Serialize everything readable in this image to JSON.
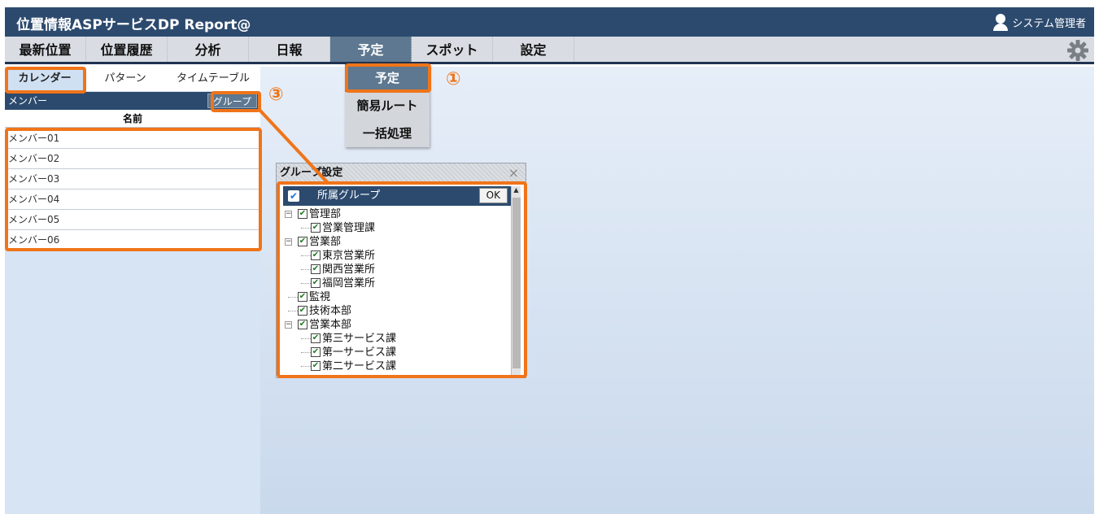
{
  "app": {
    "title": "位置情報ASPサービスDP Report@",
    "user": "システム管理者"
  },
  "nav": {
    "items": [
      "最新位置",
      "位置履歴",
      "分析",
      "日報",
      "予定",
      "スポット",
      "設定"
    ],
    "active_index": 4
  },
  "subnav": {
    "items": [
      "カレンダー",
      "パターン",
      "タイムテーブル"
    ],
    "active_index": 0
  },
  "member_panel": {
    "header": "メンバー",
    "group_button": "グループ",
    "column_name": "名前",
    "members": [
      "メンバー01",
      "メンバー02",
      "メンバー03",
      "メンバー04",
      "メンバー05",
      "メンバー06"
    ]
  },
  "dropdown": {
    "items": [
      "予定",
      "簡易ルート",
      "一括処理"
    ],
    "active_index": 0
  },
  "markers": {
    "one": "①",
    "three": "③"
  },
  "group_dialog": {
    "title": "グループ設定",
    "close_symbol": "×",
    "header_label": "所属グループ",
    "ok_label": "OK",
    "check_symbol": "✔",
    "tree": [
      {
        "label": "管理部",
        "level": 0,
        "toggle": "−"
      },
      {
        "label": "営業管理課",
        "level": 1
      },
      {
        "label": "営業部",
        "level": 0,
        "toggle": "−"
      },
      {
        "label": "東京営業所",
        "level": 1
      },
      {
        "label": "関西営業所",
        "level": 1
      },
      {
        "label": "福岡営業所",
        "level": 1
      },
      {
        "label": "監視",
        "level": 0
      },
      {
        "label": "技術本部",
        "level": 0
      },
      {
        "label": "営業本部",
        "level": 0,
        "toggle": "−"
      },
      {
        "label": "第三サービス課",
        "level": 1
      },
      {
        "label": "第一サービス課",
        "level": 1
      },
      {
        "label": "第二サービス課",
        "level": 1
      }
    ]
  },
  "colors": {
    "accent": "#f07419",
    "header": "#2c4a6e",
    "active_nav": "#5d7890"
  }
}
